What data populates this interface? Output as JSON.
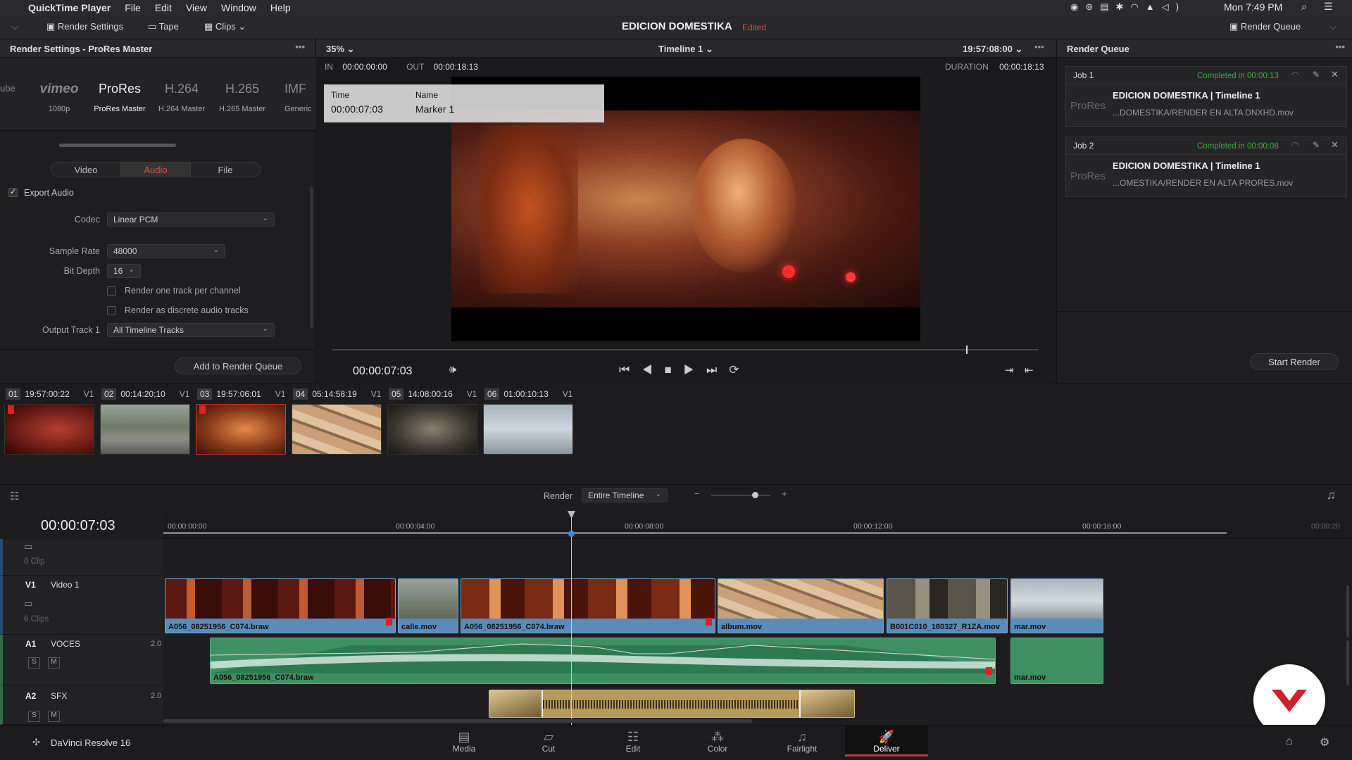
{
  "menubar": {
    "app": "QuickTime Player",
    "items": [
      "File",
      "Edit",
      "View",
      "Window",
      "Help"
    ],
    "clock": "Mon 7:49 PM"
  },
  "toolbar": {
    "render_settings": "Render Settings",
    "tape": "Tape",
    "clips": "Clips",
    "project": "EDICION DOMESTIKA",
    "edited": "Edited",
    "render_queue": "Render Queue"
  },
  "render_settings": {
    "title": "Render Settings - ProRes Master",
    "formats": [
      {
        "name": "vimeo",
        "sub": "1080p"
      },
      {
        "name": "ProRes",
        "sub": "ProRes Master"
      },
      {
        "name": "H.264",
        "sub": "H.264 Master"
      },
      {
        "name": "H.265",
        "sub": "H.265 Master"
      },
      {
        "name": "IMF",
        "sub": "Generic"
      }
    ],
    "partial_left": "ube",
    "tabs": [
      "Video",
      "Audio",
      "File"
    ],
    "export_audio": "Export Audio",
    "codec_label": "Codec",
    "codec": "Linear PCM",
    "sample_rate_label": "Sample Rate",
    "sample_rate": "48000",
    "bit_depth_label": "Bit Depth",
    "bit_depth": "16",
    "opt1": "Render one track per channel",
    "opt2": "Render as discrete audio tracks",
    "output_track_label": "Output Track 1",
    "output_track": "All Timeline Tracks",
    "add_button": "Add to Render Queue"
  },
  "viewer": {
    "zoom": "35%",
    "timeline": "Timeline 1",
    "timecode_top": "19:57:08:00",
    "in_label": "IN",
    "in": "00:00:00:00",
    "out_label": "OUT",
    "out": "00:00:18:13",
    "duration_label": "DURATION",
    "duration": "00:00:18:13",
    "marker_time_label": "Time",
    "marker_time": "00:00:07:03",
    "marker_name_label": "Name",
    "marker_name": "Marker 1",
    "current": "00:00:07:03",
    "playhead_fraction": 0.45
  },
  "render_queue": {
    "title": "Render Queue",
    "jobs": [
      {
        "label": "Job 1",
        "status": "Completed in 00:00:13",
        "title": "EDICION DOMESTIKA | Timeline 1",
        "codec": "ProRes",
        "path": "...DOMESTIKA/RENDER EN ALTA DNXHD.mov"
      },
      {
        "label": "Job 2",
        "status": "Completed in 00:00:08",
        "title": "EDICION DOMESTIKA | Timeline 1",
        "codec": "ProRes",
        "path": "...OMESTIKA/RENDER EN ALTA PRORES.mov"
      }
    ],
    "start_button": "Start Render"
  },
  "clips": [
    {
      "num": "01",
      "tc": "19:57:00:22",
      "track": "V1"
    },
    {
      "num": "02",
      "tc": "00:14:20;10",
      "track": "V1"
    },
    {
      "num": "03",
      "tc": "19:57:06:01",
      "track": "V1"
    },
    {
      "num": "04",
      "tc": "05:14:58:19",
      "track": "V1"
    },
    {
      "num": "05",
      "tc": "14:08:00:16",
      "track": "V1"
    },
    {
      "num": "06",
      "tc": "01:00:10:13",
      "track": "V1"
    }
  ],
  "timeline": {
    "render_label": "Render",
    "render_value": "Entire Timeline",
    "timecode": "00:00:07:03",
    "ruler": [
      "00:00:00:00",
      "00:00:04:00",
      "00:00:08:00",
      "00:00:12:00",
      "00:00:16:00",
      "00:00:20"
    ],
    "empty_track": "0 Clip",
    "v1": {
      "id": "V1",
      "name": "Video 1",
      "count": "6 Clips"
    },
    "a1": {
      "id": "A1",
      "name": "VOCES",
      "level": "2.0",
      "s": "S",
      "m": "M"
    },
    "a2": {
      "id": "A2",
      "name": "SFX",
      "level": "2.0",
      "s": "S",
      "m": "M"
    },
    "video_clips": [
      "A056_08251956_C074.braw",
      "calle.mov",
      "A056_08251956_C074.braw",
      "album.mov",
      "B001C010_180327_R1ZA.mov",
      "mar.mov"
    ],
    "audio_clips": [
      "A056_08251956_C074.braw",
      "mar.mov"
    ]
  },
  "bottom": {
    "app": "DaVinci Resolve 16",
    "pages": [
      "Media",
      "Cut",
      "Edit",
      "Color",
      "Fairlight",
      "Deliver"
    ],
    "active": "Deliver"
  }
}
